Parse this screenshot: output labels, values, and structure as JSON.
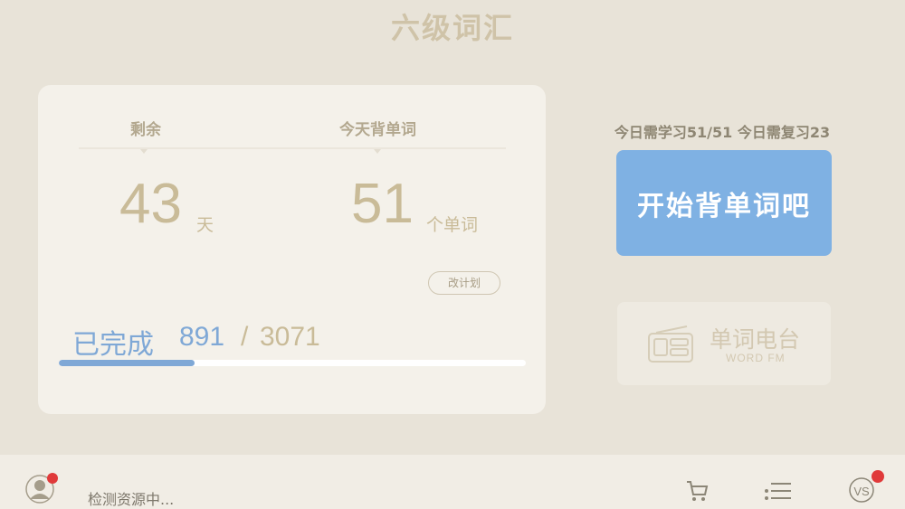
{
  "title": "六级词汇",
  "stats": {
    "remaining_label": "剩余",
    "remaining_value": "43",
    "remaining_unit": "天",
    "today_label": "今天背单词",
    "today_value": "51",
    "today_unit": "个单词",
    "change_plan_label": "改计划"
  },
  "progress": {
    "label": "已完成",
    "done": "891",
    "separator": "/",
    "total": "3071",
    "fraction": 0.29
  },
  "today_summary": "今日需学习51/51 今日需复习23",
  "start_button_label": "开始背单词吧",
  "radio": {
    "title": "单词电台",
    "subtitle": "WORD FM"
  },
  "status_text": "检测资源中...",
  "icons": [
    "avatar-icon",
    "radio-icon",
    "cart-icon",
    "list-icon",
    "vs-icon"
  ],
  "colors": {
    "accent_blue": "#7fb1e3",
    "background": "#e8e3d8",
    "badge_red": "#e03a3a"
  }
}
